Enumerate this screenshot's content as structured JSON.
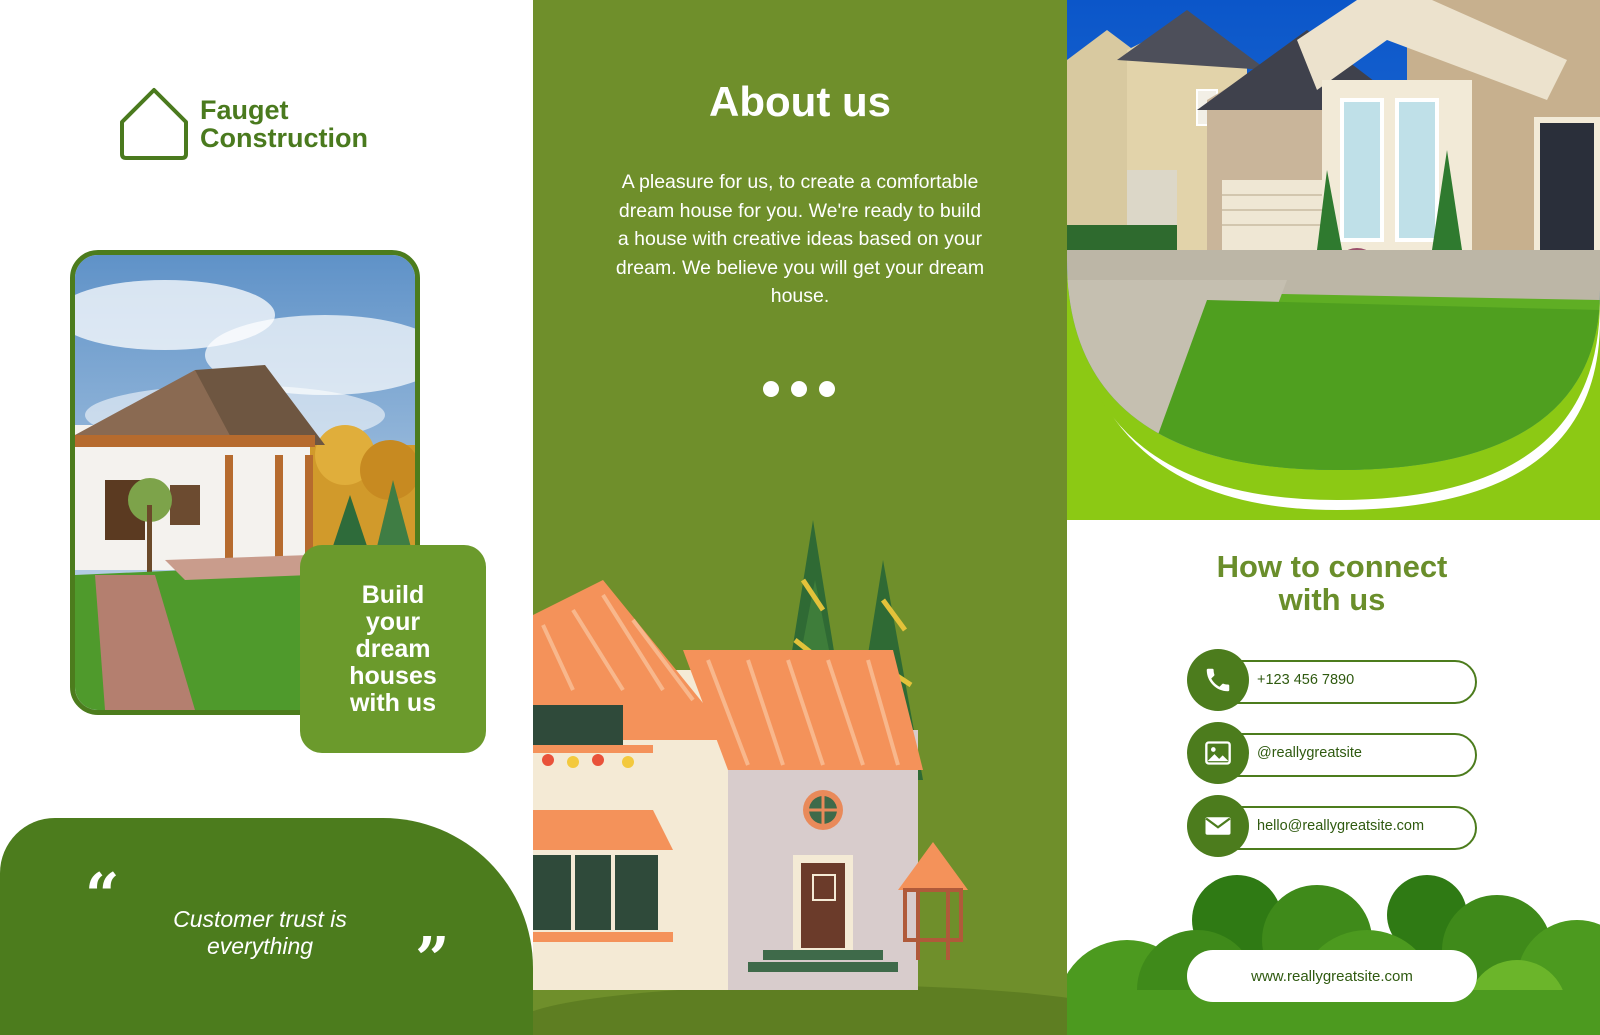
{
  "brand": {
    "line1": "Fauget",
    "line2": "Construction"
  },
  "left": {
    "tagline": [
      "Build",
      "your",
      "dream",
      "houses",
      "with us"
    ],
    "quote": {
      "text_line1": "Customer trust is",
      "text_line2": "everything",
      "open_mark": "“",
      "close_mark": "”"
    }
  },
  "middle": {
    "title": "About us",
    "body": "A pleasure for us, to create a comfortable dream house for you. We're ready to build a house with creative ideas based on your dream. We believe you will get your dream house."
  },
  "right": {
    "connect_title_line1": "How to connect",
    "connect_title_line2": "with us",
    "contacts": [
      {
        "icon": "phone-icon",
        "value": "+123 456 7890"
      },
      {
        "icon": "image-icon",
        "value": "@reallygreatsite"
      },
      {
        "icon": "mail-icon",
        "value": "hello@reallygreatsite.com"
      }
    ],
    "website": "www.reallygreatsite.com"
  },
  "colors": {
    "dark_green": "#4c7c1d",
    "olive_green": "#6f8f2b",
    "lime_accent": "#8cc914",
    "heading_green": "#6a8e2b",
    "roof_orange": "#f4925a",
    "wall_cream": "#f4ead5"
  }
}
